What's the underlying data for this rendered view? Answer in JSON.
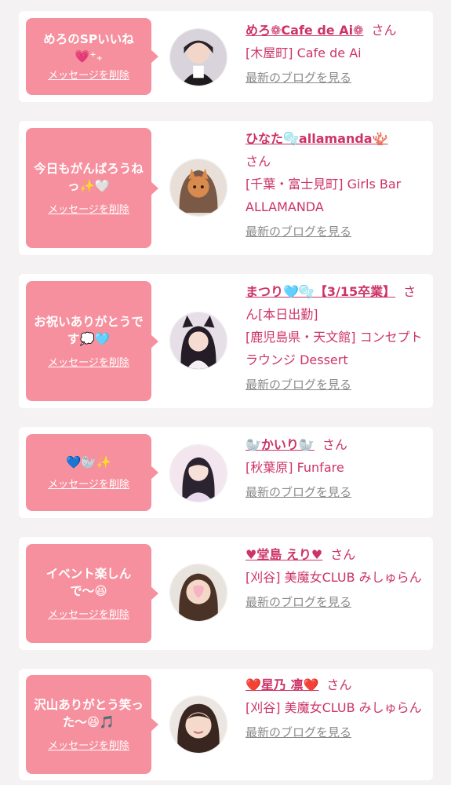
{
  "delete_label": "メッセージを削除",
  "blog_label": "最新のブログを見る",
  "san_label": "さん",
  "cards": [
    {
      "message": "めろのSPいいね💗⁺₊",
      "name": "めろ❁Cafe de Ai❁",
      "shop": "[木屋町] Cafe de Ai"
    },
    {
      "message": "今日もがんばろうねっ✨🤍",
      "name": "ひなた🫧allamanda🪸",
      "shop": "[千葉・富士見町] Girls Bar ALLAMANDA"
    },
    {
      "message": "お祝いありがとうです💭🩵",
      "name": "まつり🩵🫧【3/15卒業】",
      "shop": "[鹿児島県・天文館] コンセプトラウンジ Dessert",
      "extra": "[本日出勤]"
    },
    {
      "message": "💙🦭✨",
      "name": "🦭かいり🦭",
      "shop": "[秋葉原] Funfare"
    },
    {
      "message": "イベント楽しんで〜😆",
      "name": "♥堂島 えり♥",
      "shop": "[刈谷] 美魔女CLUB みしゅらん"
    },
    {
      "message": "沢山ありがとう笑った〜😆🎵",
      "name": "❤️星乃 凛❤️",
      "shop": "[刈谷] 美魔女CLUB みしゅらん"
    }
  ]
}
